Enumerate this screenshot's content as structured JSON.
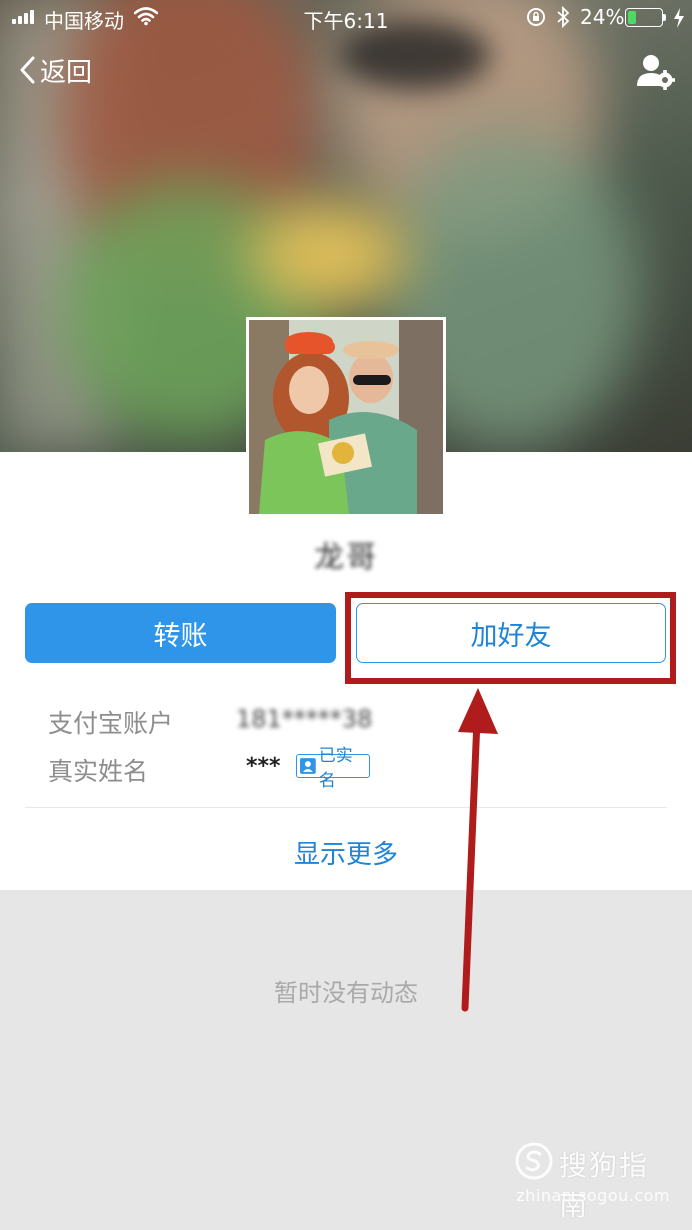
{
  "status_bar": {
    "carrier": "中国移动",
    "time": "下午6:11",
    "battery_percent": "24%",
    "battery_level": 0.24,
    "icons": [
      "signal-icon",
      "wifi-icon",
      "orientation-lock-icon",
      "bluetooth-icon",
      "battery-icon",
      "charging-bolt-icon"
    ]
  },
  "nav": {
    "back_label": "返回",
    "settings_icon": "user-settings-icon"
  },
  "profile": {
    "nickname": "龙哥",
    "transfer_label": "转账",
    "add_friend_label": "加好友",
    "account_label": "支付宝账户",
    "account_value": "181*****38",
    "realname_label": "真实姓名",
    "realname_value": "***",
    "verified_label": "已实名",
    "show_more_label": "显示更多"
  },
  "feed": {
    "empty_text": "暂时没有动态"
  },
  "watermark": {
    "brand": "搜狗指南",
    "url": "zhinan.sogou.com"
  },
  "colors": {
    "accent_blue": "#2e95e8",
    "annotation_red": "#b01c1c",
    "feed_background": "#e6e6e6"
  }
}
